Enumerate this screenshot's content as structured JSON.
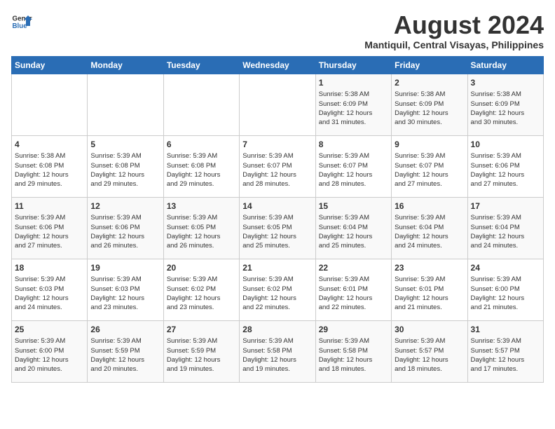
{
  "logo": {
    "line1": "General",
    "line2": "Blue"
  },
  "title": "August 2024",
  "subtitle": "Mantiquil, Central Visayas, Philippines",
  "weekdays": [
    "Sunday",
    "Monday",
    "Tuesday",
    "Wednesday",
    "Thursday",
    "Friday",
    "Saturday"
  ],
  "weeks": [
    [
      {
        "day": "",
        "info": ""
      },
      {
        "day": "",
        "info": ""
      },
      {
        "day": "",
        "info": ""
      },
      {
        "day": "",
        "info": ""
      },
      {
        "day": "1",
        "info": "Sunrise: 5:38 AM\nSunset: 6:09 PM\nDaylight: 12 hours\nand 31 minutes."
      },
      {
        "day": "2",
        "info": "Sunrise: 5:38 AM\nSunset: 6:09 PM\nDaylight: 12 hours\nand 30 minutes."
      },
      {
        "day": "3",
        "info": "Sunrise: 5:38 AM\nSunset: 6:09 PM\nDaylight: 12 hours\nand 30 minutes."
      }
    ],
    [
      {
        "day": "4",
        "info": "Sunrise: 5:38 AM\nSunset: 6:08 PM\nDaylight: 12 hours\nand 29 minutes."
      },
      {
        "day": "5",
        "info": "Sunrise: 5:39 AM\nSunset: 6:08 PM\nDaylight: 12 hours\nand 29 minutes."
      },
      {
        "day": "6",
        "info": "Sunrise: 5:39 AM\nSunset: 6:08 PM\nDaylight: 12 hours\nand 29 minutes."
      },
      {
        "day": "7",
        "info": "Sunrise: 5:39 AM\nSunset: 6:07 PM\nDaylight: 12 hours\nand 28 minutes."
      },
      {
        "day": "8",
        "info": "Sunrise: 5:39 AM\nSunset: 6:07 PM\nDaylight: 12 hours\nand 28 minutes."
      },
      {
        "day": "9",
        "info": "Sunrise: 5:39 AM\nSunset: 6:07 PM\nDaylight: 12 hours\nand 27 minutes."
      },
      {
        "day": "10",
        "info": "Sunrise: 5:39 AM\nSunset: 6:06 PM\nDaylight: 12 hours\nand 27 minutes."
      }
    ],
    [
      {
        "day": "11",
        "info": "Sunrise: 5:39 AM\nSunset: 6:06 PM\nDaylight: 12 hours\nand 27 minutes."
      },
      {
        "day": "12",
        "info": "Sunrise: 5:39 AM\nSunset: 6:06 PM\nDaylight: 12 hours\nand 26 minutes."
      },
      {
        "day": "13",
        "info": "Sunrise: 5:39 AM\nSunset: 6:05 PM\nDaylight: 12 hours\nand 26 minutes."
      },
      {
        "day": "14",
        "info": "Sunrise: 5:39 AM\nSunset: 6:05 PM\nDaylight: 12 hours\nand 25 minutes."
      },
      {
        "day": "15",
        "info": "Sunrise: 5:39 AM\nSunset: 6:04 PM\nDaylight: 12 hours\nand 25 minutes."
      },
      {
        "day": "16",
        "info": "Sunrise: 5:39 AM\nSunset: 6:04 PM\nDaylight: 12 hours\nand 24 minutes."
      },
      {
        "day": "17",
        "info": "Sunrise: 5:39 AM\nSunset: 6:04 PM\nDaylight: 12 hours\nand 24 minutes."
      }
    ],
    [
      {
        "day": "18",
        "info": "Sunrise: 5:39 AM\nSunset: 6:03 PM\nDaylight: 12 hours\nand 24 minutes."
      },
      {
        "day": "19",
        "info": "Sunrise: 5:39 AM\nSunset: 6:03 PM\nDaylight: 12 hours\nand 23 minutes."
      },
      {
        "day": "20",
        "info": "Sunrise: 5:39 AM\nSunset: 6:02 PM\nDaylight: 12 hours\nand 23 minutes."
      },
      {
        "day": "21",
        "info": "Sunrise: 5:39 AM\nSunset: 6:02 PM\nDaylight: 12 hours\nand 22 minutes."
      },
      {
        "day": "22",
        "info": "Sunrise: 5:39 AM\nSunset: 6:01 PM\nDaylight: 12 hours\nand 22 minutes."
      },
      {
        "day": "23",
        "info": "Sunrise: 5:39 AM\nSunset: 6:01 PM\nDaylight: 12 hours\nand 21 minutes."
      },
      {
        "day": "24",
        "info": "Sunrise: 5:39 AM\nSunset: 6:00 PM\nDaylight: 12 hours\nand 21 minutes."
      }
    ],
    [
      {
        "day": "25",
        "info": "Sunrise: 5:39 AM\nSunset: 6:00 PM\nDaylight: 12 hours\nand 20 minutes."
      },
      {
        "day": "26",
        "info": "Sunrise: 5:39 AM\nSunset: 5:59 PM\nDaylight: 12 hours\nand 20 minutes."
      },
      {
        "day": "27",
        "info": "Sunrise: 5:39 AM\nSunset: 5:59 PM\nDaylight: 12 hours\nand 19 minutes."
      },
      {
        "day": "28",
        "info": "Sunrise: 5:39 AM\nSunset: 5:58 PM\nDaylight: 12 hours\nand 19 minutes."
      },
      {
        "day": "29",
        "info": "Sunrise: 5:39 AM\nSunset: 5:58 PM\nDaylight: 12 hours\nand 18 minutes."
      },
      {
        "day": "30",
        "info": "Sunrise: 5:39 AM\nSunset: 5:57 PM\nDaylight: 12 hours\nand 18 minutes."
      },
      {
        "day": "31",
        "info": "Sunrise: 5:39 AM\nSunset: 5:57 PM\nDaylight: 12 hours\nand 17 minutes."
      }
    ]
  ]
}
